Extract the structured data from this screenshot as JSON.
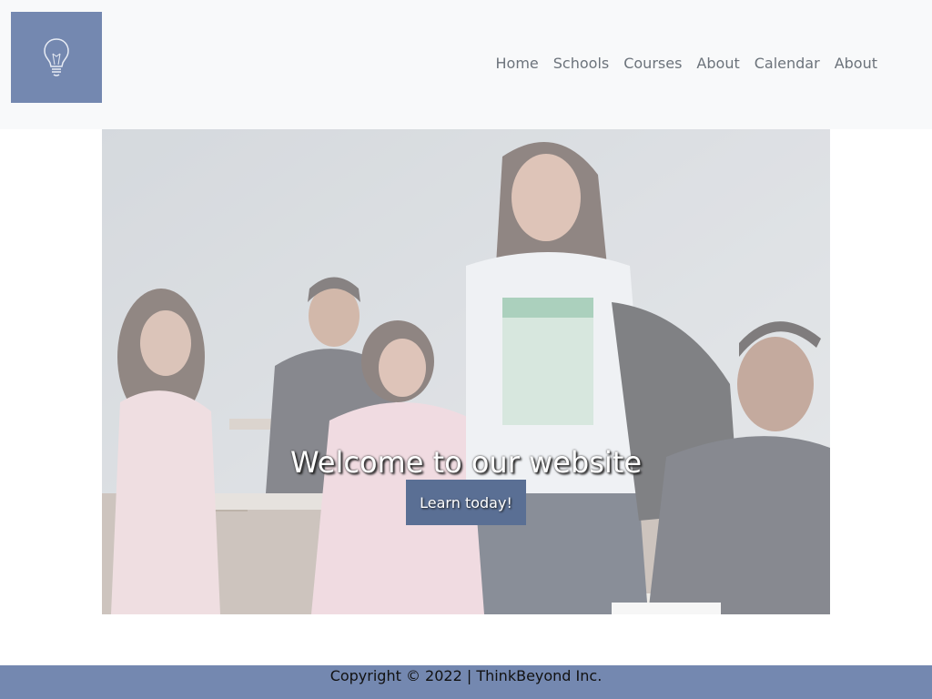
{
  "header": {
    "logo_icon": "lightbulb-icon",
    "nav": [
      {
        "label": "Home"
      },
      {
        "label": "Schools"
      },
      {
        "label": "Courses"
      },
      {
        "label": "About"
      },
      {
        "label": "Calendar"
      },
      {
        "label": "About"
      }
    ]
  },
  "hero": {
    "title": "Welcome to our website",
    "button_label": "Learn today!"
  },
  "footer": {
    "copyright": "Copyright © 2022 | ThinkBeyond Inc."
  },
  "colors": {
    "header_bg": "#f8f9fa",
    "accent": "#7488b0",
    "button_bg": "#5a6f94",
    "nav_text": "#6c737b"
  }
}
